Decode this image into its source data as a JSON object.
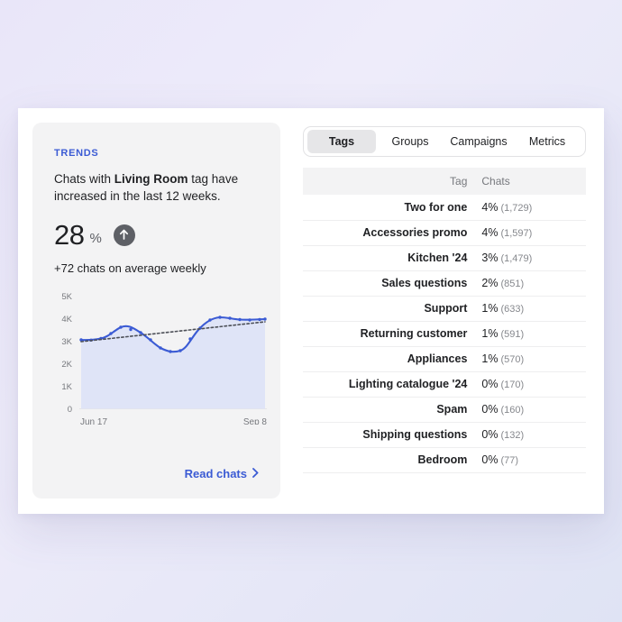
{
  "trends": {
    "label": "TRENDS",
    "sentence_pre": "Chats with ",
    "sentence_bold": "Living Room",
    "sentence_post": " tag have increased in the last 12 weeks.",
    "stat_value": "28",
    "stat_unit": "%",
    "trend_direction_icon": "arrow-up-icon",
    "subtext": "+72 chats on average weekly",
    "link_label": "Read chats",
    "link_icon": "chevron-right-icon",
    "accent_color": "#3b5bd4",
    "card_bg": "#f3f3f4"
  },
  "chart_data": {
    "type": "area",
    "title": "",
    "xlabel": "",
    "ylabel": "",
    "ylim": [
      0,
      5000
    ],
    "grid": false,
    "y_ticks": [
      "0",
      "1K",
      "2K",
      "3K",
      "4K",
      "5K"
    ],
    "y_tick_values": [
      0,
      1000,
      2000,
      3000,
      4000,
      5000
    ],
    "x_ticks": [
      "Jun 17",
      "Sep 8"
    ],
    "x_start_label": "Jun 17",
    "x_end_label": "Sep 8",
    "series": [
      {
        "name": "Chats",
        "style": "solid-line-with-markers",
        "color": "#3b5bd4",
        "fill_color": "#dfe4f7",
        "x": [
          0,
          1,
          2,
          3,
          4,
          5,
          6,
          7,
          8,
          9,
          10,
          11,
          12,
          13,
          14,
          15,
          16,
          17,
          18,
          19
        ],
        "values": [
          3080,
          3070,
          3080,
          3100,
          3200,
          3450,
          3620,
          3500,
          3300,
          3050,
          2820,
          2790,
          2950,
          3350,
          3800,
          4050,
          3980,
          3930,
          3900,
          3920
        ]
      },
      {
        "name": "Trend",
        "style": "dotted-line",
        "color": "#4c4f57",
        "x": [
          0,
          19
        ],
        "values": [
          3020,
          3900
        ]
      }
    ]
  },
  "tabs": [
    {
      "label": "Tags",
      "active": true
    },
    {
      "label": "Groups",
      "active": false
    },
    {
      "label": "Campaigns",
      "active": false
    },
    {
      "label": "Metrics",
      "active": false
    }
  ],
  "table": {
    "columns": [
      "Tag",
      "Chats"
    ],
    "rows": [
      {
        "tag": "Two for one",
        "pct": "4%",
        "count": "(1,729)"
      },
      {
        "tag": "Accessories promo",
        "pct": "4%",
        "count": "(1,597)"
      },
      {
        "tag": "Kitchen '24",
        "pct": "3%",
        "count": "(1,479)"
      },
      {
        "tag": "Sales questions",
        "pct": "2%",
        "count": "(851)"
      },
      {
        "tag": "Support",
        "pct": "1%",
        "count": "(633)"
      },
      {
        "tag": "Returning customer",
        "pct": "1%",
        "count": "(591)"
      },
      {
        "tag": "Appliances",
        "pct": "1%",
        "count": "(570)"
      },
      {
        "tag": "Lighting catalogue '24",
        "pct": "0%",
        "count": "(170)"
      },
      {
        "tag": "Spam",
        "pct": "0%",
        "count": "(160)"
      },
      {
        "tag": "Shipping questions",
        "pct": "0%",
        "count": "(132)"
      },
      {
        "tag": "Bedroom",
        "pct": "0%",
        "count": "(77)"
      }
    ]
  }
}
